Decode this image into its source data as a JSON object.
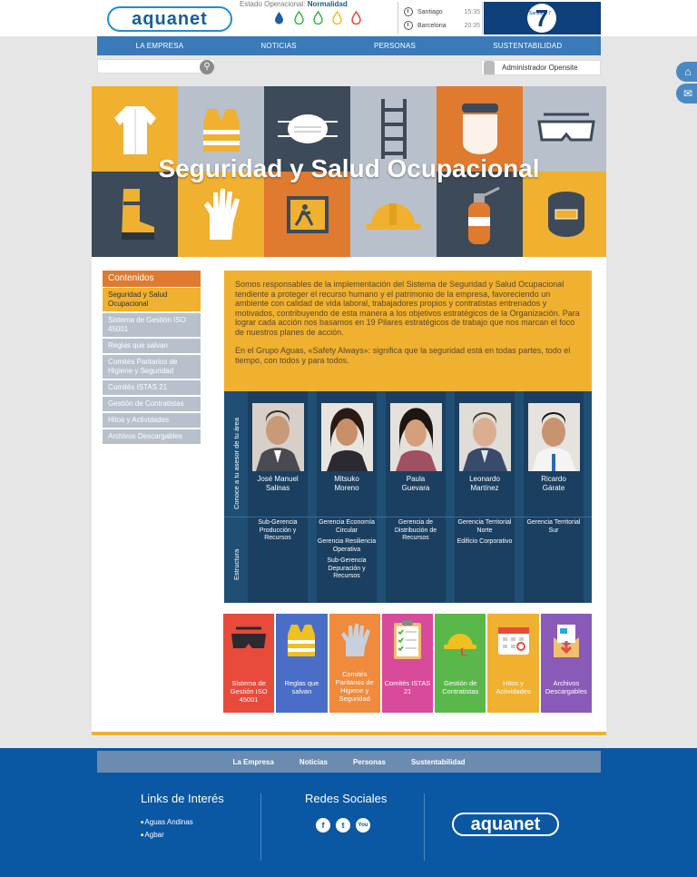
{
  "header": {
    "logo_text": "aquanet",
    "estado_label": "Estado Operacional:",
    "estado_value": "Normalidad",
    "drop_colors": [
      "#1a5fa8",
      "#3ab54a",
      "#3ab54a",
      "#f0c020",
      "#e84a30"
    ],
    "clocks": [
      {
        "city": "Santiago",
        "time": "15:35"
      },
      {
        "city": "Barcelona",
        "time": "20:35"
      }
    ],
    "banner_text": "Santiago 7"
  },
  "nav": {
    "items": [
      "LA EMPRESA",
      "NOTICIAS",
      "PERSONAS",
      "SUSTENTABILIDAD"
    ]
  },
  "search": {
    "placeholder": "",
    "icon": "search-icon"
  },
  "user": {
    "name": "Administrador Opensite"
  },
  "side_buttons": [
    {
      "icon": "home-icon"
    },
    {
      "icon": "mail-icon"
    }
  ],
  "hero": {
    "title": "Seguridad y Salud Ocupacional",
    "tiles": [
      {
        "bg": "#f0b030",
        "icon": "lab-coat-icon"
      },
      {
        "bg": "#b8c0cc",
        "icon": "safety-vest-icon"
      },
      {
        "bg": "#3c4a5a",
        "icon": "mask-icon"
      },
      {
        "bg": "#b8c0cc",
        "icon": "ladder-icon"
      },
      {
        "bg": "#e07a2e",
        "icon": "face-shield-icon"
      },
      {
        "bg": "#b8c0cc",
        "icon": "goggles-icon"
      },
      {
        "bg": "#3c4a5a",
        "icon": "boot-icon"
      },
      {
        "bg": "#f0b030",
        "icon": "glove-icon"
      },
      {
        "bg": "#e07a2e",
        "icon": "exit-sign-icon"
      },
      {
        "bg": "#b8c0cc",
        "icon": "hard-hat-icon"
      },
      {
        "bg": "#3c4a5a",
        "icon": "extinguisher-icon"
      },
      {
        "bg": "#f0b030",
        "icon": "welding-mask-icon"
      }
    ]
  },
  "menu": {
    "title": "Contenidos",
    "items": [
      "Seguridad y Salud Ocupacional",
      "Sistema de Gestión ISO 45001",
      "Reglas que salvan",
      "Comités Paritarios de Higiene y Seguridad",
      "Comités ISTAS 21",
      "Gestión de Contratistas",
      "Hitos y Actividades",
      "Archivos Descargables"
    ]
  },
  "intro": {
    "p1": "Somos responsables de la implementación del Sistema de Seguridad y Salud Ocupacional tendiente a proteger el recurso humano y el patrimonio de la empresa, favoreciendo un ambiente con calidad de vida laboral, trabajadores propios y contratistas entrenados y motivados, contribuyendo de esta manera a los objetivos estratégicos de la Organización. Para lograr cada acción nos basamos en 19 Pilares estratégicos de trabajo que nos marcan el foco de nuestros planes de acción.",
    "p2": "En el Grupo Aguas, «Safety Always»: significa que la seguridad está en todas partes, todo el tiempo, con todos y para todos."
  },
  "team": {
    "label_top": "Conoce a tu asesor de tu área",
    "label_bottom": "Estructura",
    "members": [
      {
        "first": "José Manuel",
        "last": "Salinas",
        "areas": [
          "Sub-Gerencia Producción y Recursos"
        ]
      },
      {
        "first": "Mitsuko",
        "last": "Moreno",
        "areas": [
          "Gerencia Economía Circular",
          "Gerencia Resiliencia Operativa",
          "Sub-Gerencia Depuración y Recursos"
        ]
      },
      {
        "first": "Paula",
        "last": "Guevara",
        "areas": [
          "Gerencia de Distribución de Recursos"
        ]
      },
      {
        "first": "Leonardo",
        "last": "Martínez",
        "areas": [
          "Gerencia Territorial Norte",
          "Edificio Corporativo"
        ]
      },
      {
        "first": "Ricardo",
        "last": "Gárate",
        "areas": [
          "Gerencia Territorial Sur"
        ]
      }
    ]
  },
  "cards": [
    {
      "label": "Sistema de Gestión ISO 45001",
      "color": "#e84a3c",
      "icon": "goggles-icon"
    },
    {
      "label": "Reglas que salvan",
      "color": "#4a6ec8",
      "icon": "safety-vest-icon"
    },
    {
      "label": "Comités Paritarios de Higiene y Seguridad",
      "color": "#f08a3c",
      "icon": "glove-icon"
    },
    {
      "label": "Comités ISTAS 21",
      "color": "#d84a9a",
      "icon": "checklist-icon"
    },
    {
      "label": "Gestión de Contratistas",
      "color": "#5ab84a",
      "icon": "hard-hat-icon"
    },
    {
      "label": "Hitos y Actividades",
      "color": "#f0b030",
      "icon": "calendar-icon"
    },
    {
      "label": "Archivos Descargables",
      "color": "#8a5ab8",
      "icon": "download-icon"
    }
  ],
  "footer": {
    "nav": [
      "La Empresa",
      "Noticias",
      "Personas",
      "Sustentabilidad"
    ],
    "links_title": "Links de Interés",
    "links": [
      "Aguas Andinas",
      "Agbar"
    ],
    "social_title": "Redes Sociales",
    "social": [
      {
        "icon": "facebook-icon",
        "glyph": "f"
      },
      {
        "icon": "twitter-icon",
        "glyph": "t"
      },
      {
        "icon": "youtube-icon",
        "glyph": "You"
      }
    ],
    "logo_text": "aquanet"
  }
}
